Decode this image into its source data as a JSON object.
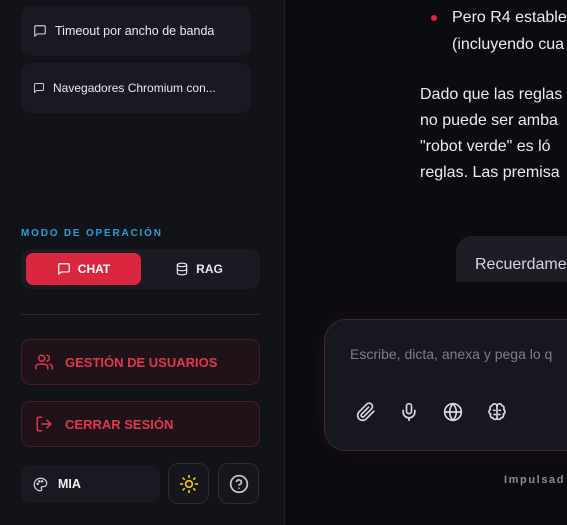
{
  "sidebar": {
    "conversations": [
      {
        "label": "Timeout por ancho de banda"
      },
      {
        "label": "Navegadores Chromium con..."
      }
    ],
    "mode_section": {
      "title": "MODO DE OPERACIÓN",
      "options": [
        {
          "label": "CHAT",
          "icon": "message-square-icon",
          "active": true
        },
        {
          "label": "RAG",
          "icon": "database-icon",
          "active": false
        }
      ]
    },
    "actions": {
      "user_management": "GESTIÓN DE USUARIOS",
      "logout": "CERRAR SESIÓN"
    },
    "footer": {
      "theme_name": "MIA",
      "theme_icon": "palette-icon",
      "light_mode_icon": "sun-icon",
      "help_icon": "help-circle-icon"
    }
  },
  "chat": {
    "assistant_text": {
      "bullet_line1": "Pero R4 estable",
      "bullet_line2": "(incluyendo cua",
      "para_line1": "Dado que las reglas",
      "para_line2": "no puede ser amba",
      "para_line3": "\"robot verde\" es ló",
      "para_line4": "reglas. Las premisa"
    },
    "user_message": "Recuerdame",
    "composer": {
      "placeholder": "Escribe, dicta, anexa y pega lo q",
      "tools": [
        "paperclip-icon",
        "mic-icon",
        "globe-icon",
        "brain-icon"
      ]
    },
    "powered_by": "Impulsad"
  },
  "colors": {
    "accent": "#d8273f",
    "mode_title": "#2a9fd6",
    "sidebar_bg": "#121219",
    "main_bg": "#0b0b10"
  }
}
